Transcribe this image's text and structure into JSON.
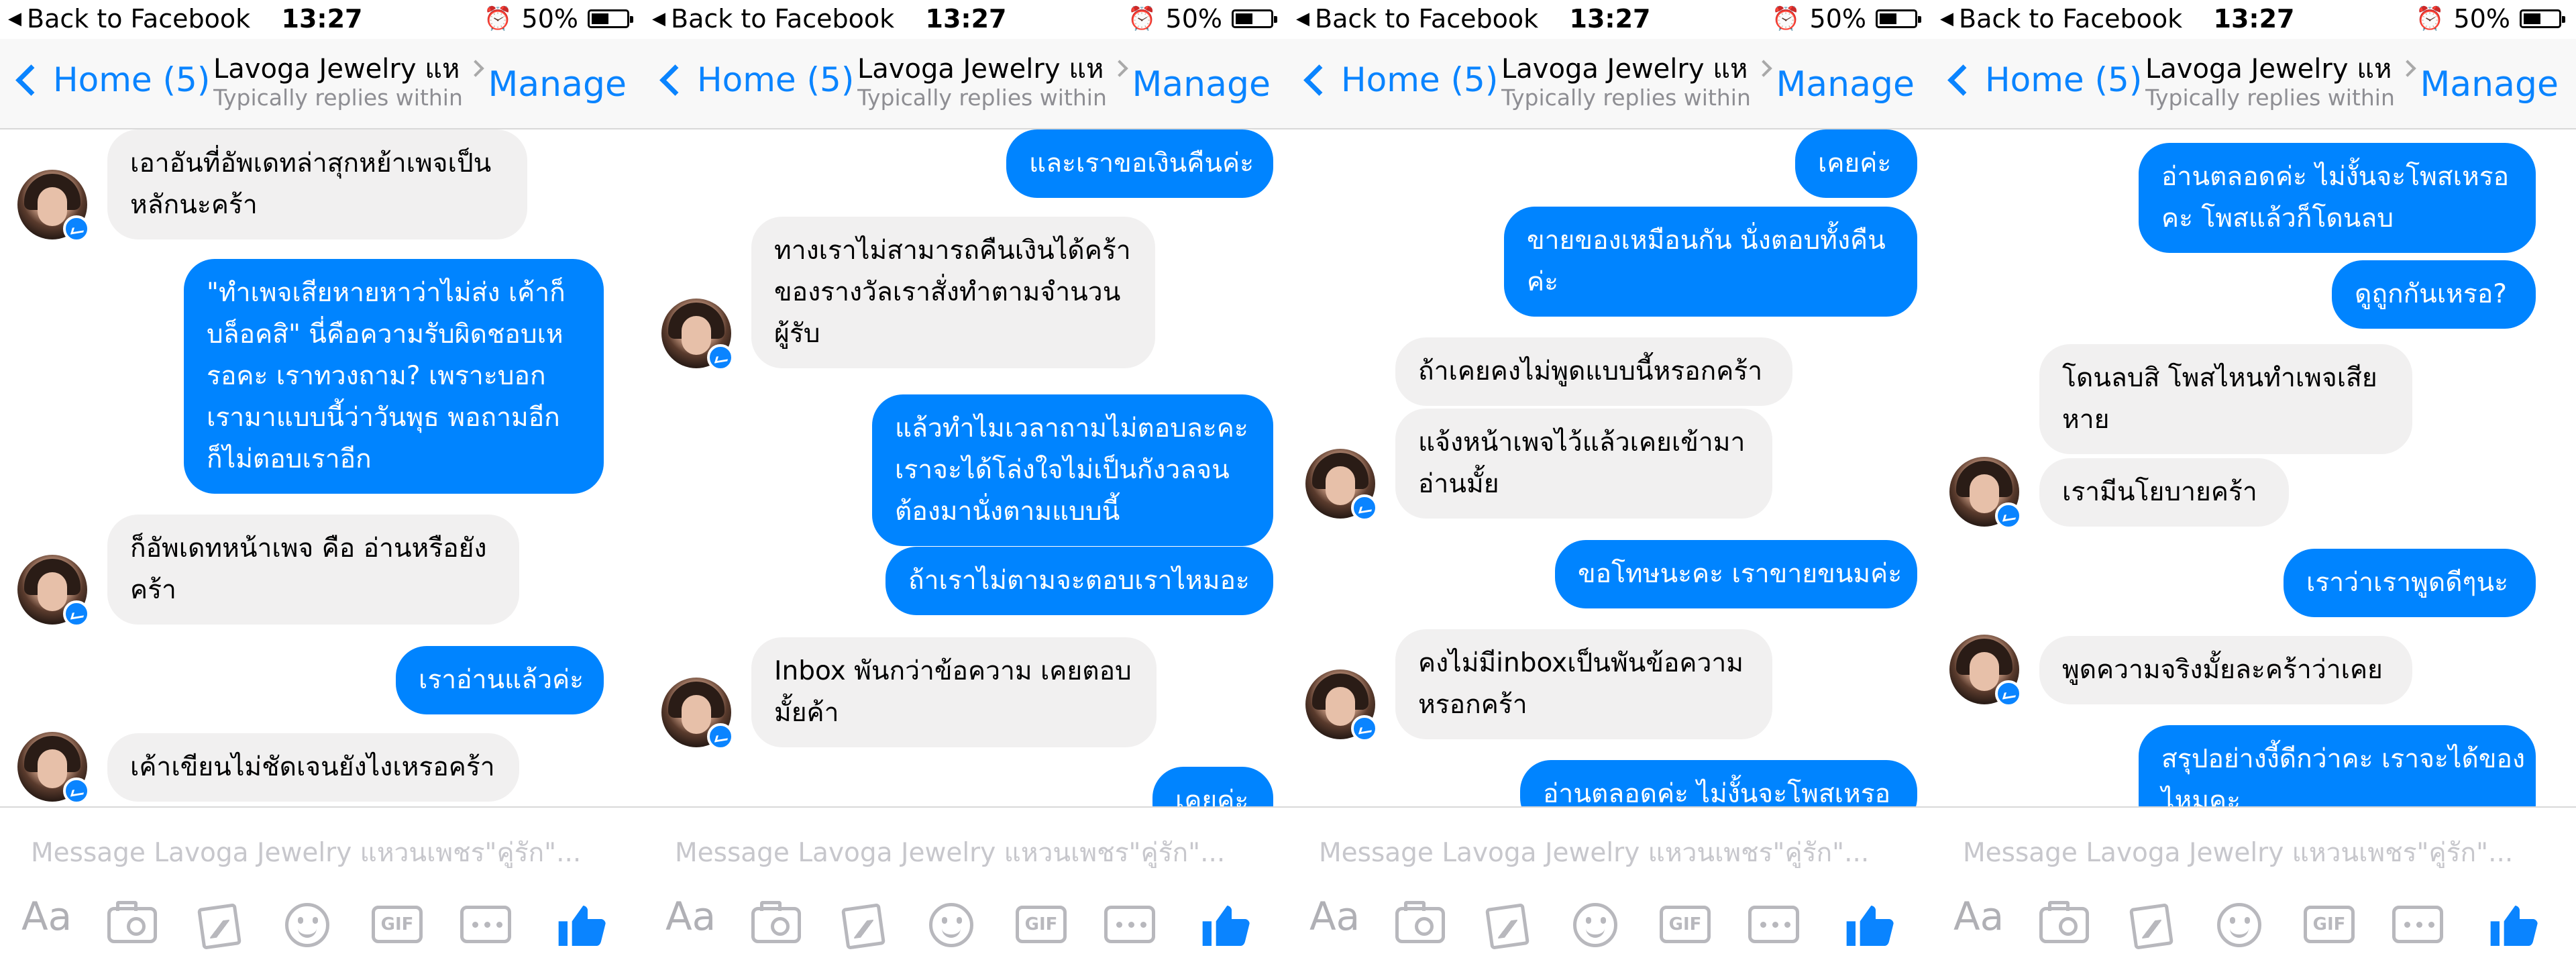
{
  "status_bar": {
    "back_label": "Back to Facebook",
    "time": "13:27",
    "battery": "50%",
    "battery_level": 0.5
  },
  "nav": {
    "back_label": "Home (5)",
    "title": "Lavoga Jewelry แห...",
    "subtitle": "Typically replies within a...",
    "manage_label": "Manage"
  },
  "composer": {
    "placeholder": "Message Lavoga Jewelry แหวนเพชร\"คู่รัก\"...",
    "aa_label": "Aa",
    "gif_label": "GIF"
  },
  "icons": {
    "camera": "camera-icon",
    "gallery": "gallery-icon",
    "emoji": "emoji-icon",
    "gif": "gif-icon",
    "more": "more-icon",
    "like": "thumbs-up-icon"
  },
  "colors": {
    "accent": "#0a84ff",
    "outgoing_bubble": "#0084ff",
    "incoming_bubble": "#f1f0f0"
  },
  "panels": [
    {
      "messages": [
        {
          "side": "in",
          "lines": [
            "เอาอันที่อัพเดทล่าสุกหย้าเพจเป็น",
            "หลักนะคร้า"
          ],
          "avatar": true
        },
        {
          "side": "out",
          "lines": [
            "\"ทำเพจเสียหายหาว่าไม่ส่ง เค้าก็",
            "บล็อคสิ\" นี่คือความรับผิดชอบเห",
            "รอคะ เราทวงถาม? เพราะบอก",
            "เรามาแบบนี้ว่าวันพุธ พอถามอีก",
            "ก็ไม่ตอบเราอีก"
          ]
        },
        {
          "side": "in",
          "lines": [
            "ก็อัพเดทหน้าเพจ คือ อ่านหรือยัง",
            "คร้า"
          ],
          "avatar": true
        },
        {
          "side": "out",
          "lines": [
            "เราอ่านแล้วค่ะ"
          ]
        },
        {
          "side": "in",
          "lines": [
            "เค้าเขียนไม่ชัดเจนยังไงเหรอคร้า"
          ],
          "avatar": true
        }
      ]
    },
    {
      "messages": [
        {
          "side": "out",
          "lines": [
            "และเราขอเงินคืนค่ะ"
          ]
        },
        {
          "side": "in",
          "lines": [
            "ทางเราไม่สามารถคืนเงินได้คร้า",
            "ของรางวัลเราสั่งทำตามจำนวน",
            "ผู้รับ"
          ],
          "avatar": true
        },
        {
          "side": "out",
          "lines": [
            "แล้วทำไมเวลาถามไม่ตอบละคะ",
            "เราจะได้โล่งใจไม่เป็นกังวลจน",
            "ต้องมานั่งตามแบบนี้"
          ]
        },
        {
          "side": "out",
          "lines": [
            "ถ้าเราไม่ตามจะตอบเราไหมอะ"
          ]
        },
        {
          "side": "in",
          "lines": [
            "Inbox พันกว่าข้อความ เคยตอบ",
            "มั้ยค้า"
          ],
          "avatar": true
        },
        {
          "side": "out",
          "lines": [
            "เคยค่ะ"
          ]
        }
      ]
    },
    {
      "messages": [
        {
          "side": "out",
          "lines": [
            "เคยค่ะ"
          ]
        },
        {
          "side": "out",
          "lines": [
            "ขายของเหมือนกัน นั่งตอบทั้งคืน",
            "ค่ะ"
          ]
        },
        {
          "side": "in",
          "lines": [
            "ถ้าเคยคงไม่พูดแบบนี้หรอกคร้า"
          ]
        },
        {
          "side": "in",
          "lines": [
            "แจ้งหน้าเพจไว้แล้วเคยเข้ามา",
            "อ่านมั้ย"
          ],
          "avatar": true
        },
        {
          "side": "out",
          "lines": [
            "ขอโทษนะคะ เราขายขนมค่ะ"
          ]
        },
        {
          "side": "in",
          "lines": [
            "คงไม่มีinboxเป็นพันข้อความ",
            "หรอกคร้า"
          ],
          "avatar": true
        },
        {
          "side": "out",
          "lines": [
            "อ่านตลอดค่ะ ไม่งั้นจะโพสเหรอ"
          ]
        }
      ]
    },
    {
      "messages": [
        {
          "side": "out",
          "lines": [
            "อ่านตลอดค่ะ ไม่งั้นจะโพสเหรอ",
            "คะ โพสแล้วก็โดนลบ"
          ]
        },
        {
          "side": "out",
          "lines": [
            "ดูถูกกันเหรอ?"
          ]
        },
        {
          "side": "in",
          "lines": [
            "โดนลบสิ โพสไหนทำเพจเสีย",
            "หาย"
          ]
        },
        {
          "side": "in",
          "lines": [
            "เรามีนโยบายคร้า"
          ],
          "avatar": true
        },
        {
          "side": "out",
          "lines": [
            "เราว่าเราพูดดีๆนะ"
          ]
        },
        {
          "side": "in",
          "lines": [
            "พูดความจริงมั้ยละคร้าว่าเคย"
          ],
          "avatar": true
        },
        {
          "side": "out",
          "lines": [
            "สรุปอย่างงี้ดีกว่าคะ เราจะได้ของ",
            "ไหมคะ"
          ]
        }
      ]
    }
  ]
}
